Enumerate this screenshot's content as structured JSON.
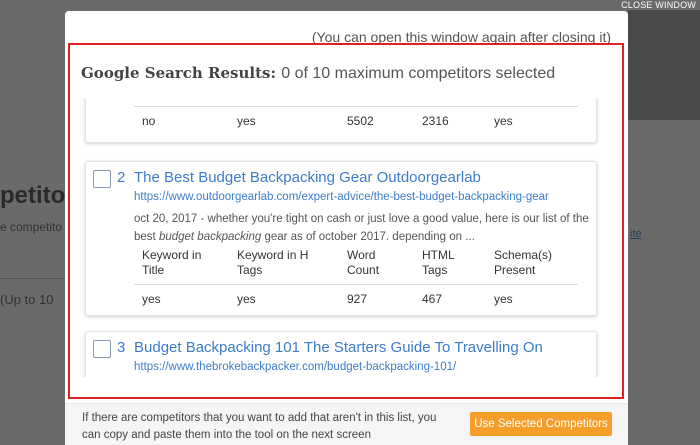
{
  "window": {
    "close_label": "CLOSE WINDOW"
  },
  "background": {
    "title_fragment": "petito",
    "subtitle_fragment": "e competito",
    "upto_fragment": "(Up to 10",
    "link_fragment": "ite"
  },
  "modal": {
    "note": "(You can open this window again after closing it)",
    "title": "Google Search Results:",
    "count_text": "0 of 10 maximum competitors selected"
  },
  "columns": {
    "keyword_title_1": "Keyword in",
    "keyword_title_2": "Title",
    "keyword_tags_1": "Keyword in H",
    "keyword_tags_2": "Tags",
    "word_count_1": "Word",
    "word_count_2": "Count",
    "html_tags_1": "HTML",
    "html_tags_2": "Tags",
    "schema_1": "Schema(s)",
    "schema_2": "Present"
  },
  "results": [
    {
      "keyword_title": "no",
      "keyword_tags": "yes",
      "word_count": "5502",
      "html_tags": "2316",
      "schema": "yes"
    },
    {
      "number": "2",
      "title": "The Best Budget Backpacking Gear Outdoorgearlab",
      "url": "https://www.outdoorgearlab.com/expert-advice/the-best-budget-backpacking-gear",
      "desc_a": "oct 20, 2017 - whether you're tight on cash or just love a good value, here is our list of the best ",
      "desc_em": "budget backpacking",
      "desc_b": " gear as of october 2017. depending on ...",
      "keyword_title": "yes",
      "keyword_tags": "yes",
      "word_count": "927",
      "html_tags": "467",
      "schema": "yes"
    },
    {
      "number": "3",
      "title": "Budget Backpacking 101 The Starters Guide To Travelling On",
      "url": "https://www.thebrokebackpacker.com/budget-backpacking-101/"
    }
  ],
  "footer": {
    "text": "If there are competitors that you want to add that aren't in this list, you can copy and paste them into the tool on the next screen",
    "button_label": "Use Selected Competitors"
  },
  "colors": {
    "accent_orange": "#f59e2b",
    "link_blue": "#3d7cc9",
    "highlight_red": "#e02020"
  }
}
